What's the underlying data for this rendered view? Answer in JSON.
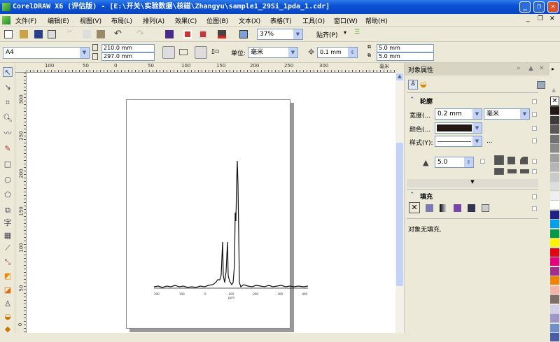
{
  "window": {
    "title": "CorelDRAW X6 (评估版) - [E:\\开关\\实验数据\\核磁\\Zhangyu\\sample1_29Si_1pda_1.cdr]"
  },
  "menu": [
    "文件(F)",
    "编辑(E)",
    "视图(V)",
    "布局(L)",
    "排列(A)",
    "效果(C)",
    "位图(B)",
    "文本(X)",
    "表格(T)",
    "工具(O)",
    "窗口(W)",
    "帮助(H)"
  ],
  "toolbar": {
    "zoom": "37%",
    "snap": "贴齐(P)"
  },
  "propbar": {
    "page_size": "A4",
    "width": "210.0 mm",
    "height": "297.0 mm",
    "unit_label": "单位:",
    "unit": "毫米",
    "nudge": "0.1 mm",
    "dup_x": "5.0 mm",
    "dup_y": "5.0 mm"
  },
  "ruler": {
    "h": [
      "100",
      "50",
      "0",
      "50",
      "100",
      "150",
      "200",
      "250",
      "300"
    ],
    "v": [
      "300",
      "250",
      "200",
      "150",
      "100",
      "50",
      "0"
    ],
    "unit": "毫米"
  },
  "spectrum": {
    "ticks": [
      "200",
      "100",
      "0",
      "-100",
      "-200",
      "-300",
      "-400"
    ],
    "axis_unit": "ppm"
  },
  "docker": {
    "title": "对象属性",
    "outline": "轮廓",
    "width_label": "宽度(...",
    "width_value": "0.2 mm",
    "width_unit": "毫米",
    "color_label": "颜色(...",
    "style_label": "样式(Y):",
    "more": "...",
    "miter": "5.0",
    "fill": "填充",
    "fill_status": "对象无填充.",
    "outline_color": "#231816"
  },
  "palette": [
    "#231816",
    "#3e3a39",
    "#595757",
    "#727171",
    "#898989",
    "#9fa0a0",
    "#b5b5b6",
    "#c9caca",
    "#dcdddd",
    "#efefef",
    "#ffffff",
    "#1d2088",
    "#00a0e9",
    "#009944",
    "#fff100",
    "#e60012",
    "#e4007f",
    "#a0308c",
    "#f08300",
    "#f5b2a6",
    "#7d6e68",
    "#d2d0e6",
    "#9f97c9",
    "#6f8fc9",
    "#4a5ba8"
  ]
}
